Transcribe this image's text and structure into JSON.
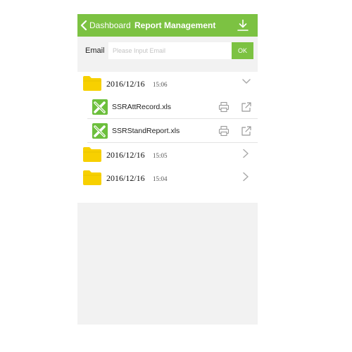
{
  "navbar": {
    "back_label": "Dashboard",
    "title": "Report Management",
    "accent": "#7cc242"
  },
  "email": {
    "label": "Email",
    "placeholder": "Please Input Email",
    "value": "",
    "ok_label": "OK"
  },
  "groups": [
    {
      "date": "2016/12/16",
      "time": "15:06",
      "expanded": true,
      "files": [
        {
          "name": "SSRAttRecord.xls"
        },
        {
          "name": "SSRStandReport.xls"
        }
      ]
    },
    {
      "date": "2016/12/16",
      "time": "15:05",
      "expanded": false,
      "files": []
    },
    {
      "date": "2016/12/16",
      "time": "15:04",
      "expanded": false,
      "files": []
    }
  ],
  "icons": {
    "back": "chevron-left-icon",
    "download": "download-icon",
    "folder": "folder-icon",
    "file": "excel-file-icon",
    "print": "printer-icon",
    "share": "share-icon",
    "expanded": "chevron-down-icon",
    "collapsed": "chevron-right-icon"
  },
  "colors": {
    "folder": "#f7d000",
    "file_icon": "#6cbf3c",
    "background": "#f2f2f2"
  }
}
